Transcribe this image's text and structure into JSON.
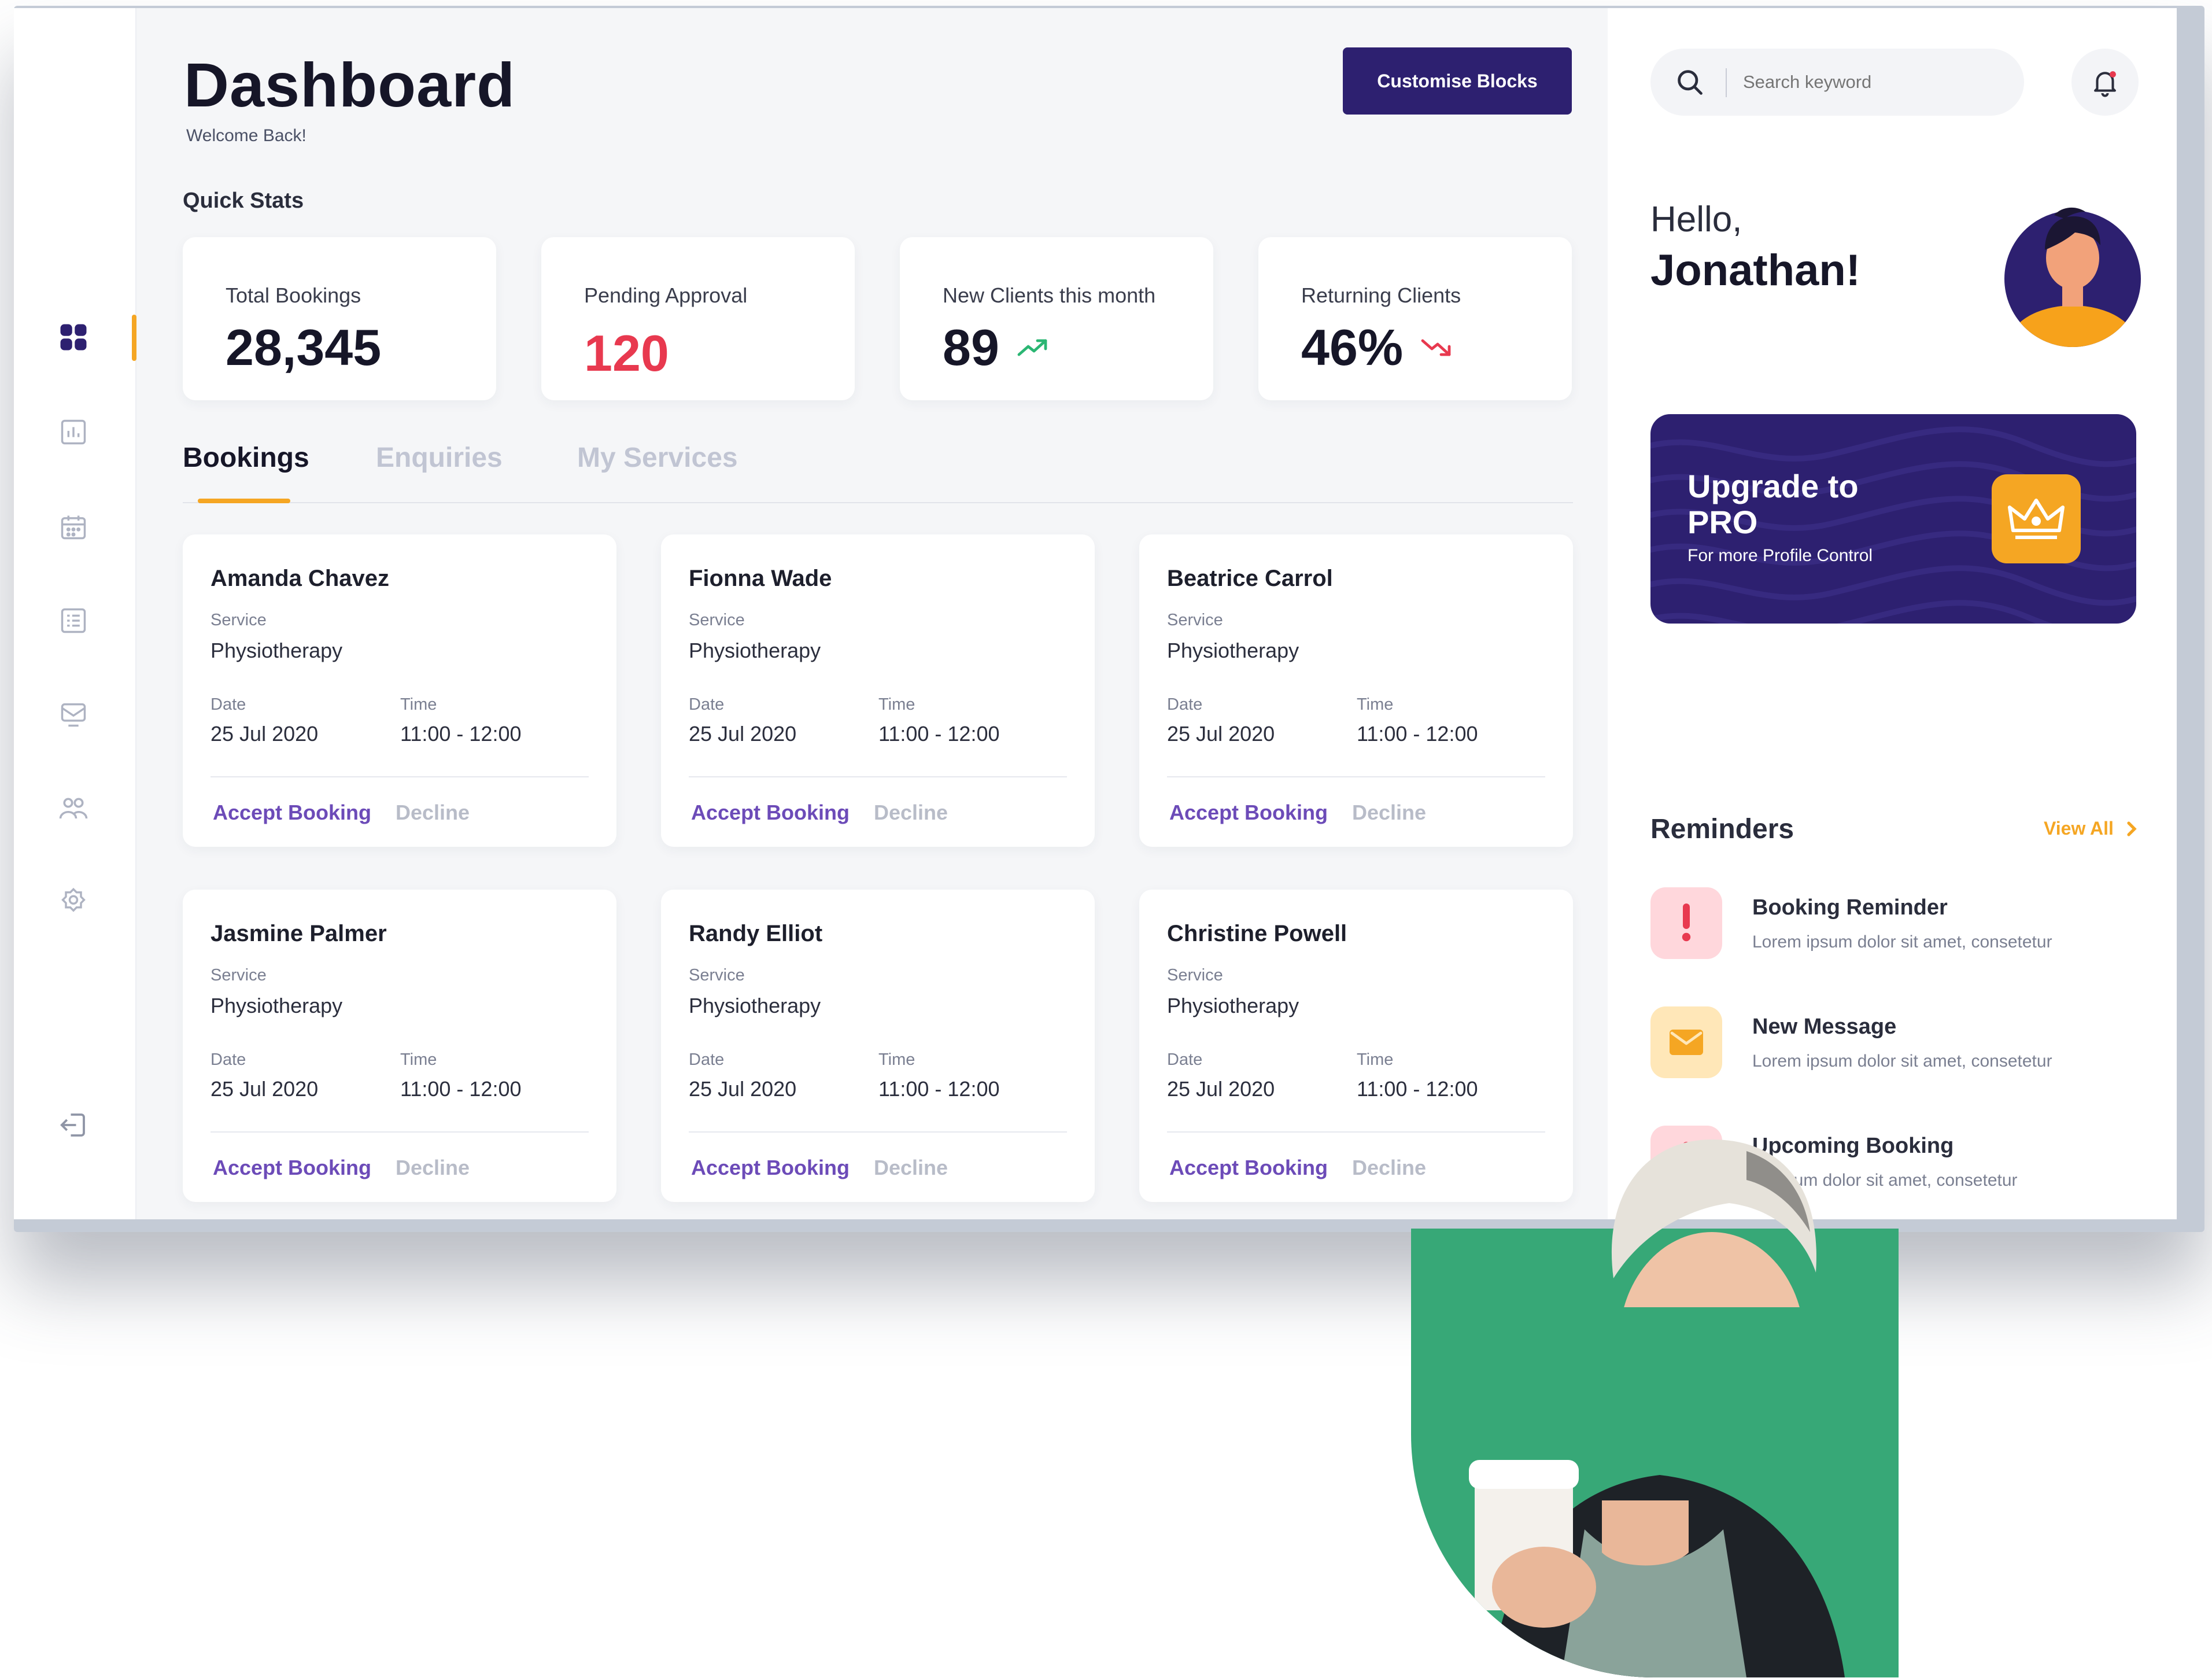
{
  "header": {
    "title": "Dashboard",
    "subtitle": "Welcome Back!",
    "customise_label": "Customise Blocks"
  },
  "quick_stats": {
    "label": "Quick Stats",
    "cards": [
      {
        "label": "Total Bookings",
        "value": "28,345",
        "trend": "none"
      },
      {
        "label": "Pending Approval",
        "value": "120",
        "trend": "none",
        "color": "#e8394f"
      },
      {
        "label": "New Clients this month",
        "value": "89",
        "trend": "up",
        "trend_color": "#2bb673"
      },
      {
        "label": "Returning Clients",
        "value": "46%",
        "trend": "down",
        "trend_color": "#e8394f"
      }
    ]
  },
  "tabs": [
    {
      "label": "Bookings",
      "active": true
    },
    {
      "label": "Enquiries",
      "active": false
    },
    {
      "label": "My Services",
      "active": false
    }
  ],
  "booking_labels": {
    "service": "Service",
    "date": "Date",
    "time": "Time",
    "accept": "Accept Booking",
    "decline": "Decline"
  },
  "bookings": [
    {
      "name": "Amanda Chavez",
      "service": "Physiotherapy",
      "date": "25 Jul 2020",
      "time": "11:00 - 12:00"
    },
    {
      "name": "Fionna Wade",
      "service": "Physiotherapy",
      "date": "25 Jul 2020",
      "time": "11:00 - 12:00"
    },
    {
      "name": "Beatrice Carrol",
      "service": "Physiotherapy",
      "date": "25 Jul 2020",
      "time": "11:00 - 12:00"
    },
    {
      "name": "Jasmine Palmer",
      "service": "Physiotherapy",
      "date": "25 Jul 2020",
      "time": "11:00 - 12:00"
    },
    {
      "name": "Randy Elliot",
      "service": "Physiotherapy",
      "date": "25 Jul 2020",
      "time": "11:00 - 12:00"
    },
    {
      "name": "Christine Powell",
      "service": "Physiotherapy",
      "date": "25 Jul 2020",
      "time": "11:00 - 12:00"
    }
  ],
  "sidebar": {
    "items": [
      {
        "icon": "dashboard-grid-icon",
        "active": true
      },
      {
        "icon": "chart-icon",
        "active": false
      },
      {
        "icon": "calendar-icon",
        "active": false
      },
      {
        "icon": "list-icon",
        "active": false
      },
      {
        "icon": "inbox-icon",
        "active": false
      },
      {
        "icon": "users-icon",
        "active": false
      },
      {
        "icon": "settings-icon",
        "active": false
      }
    ],
    "logout_icon": "logout-icon"
  },
  "right_panel": {
    "search_placeholder": "Search keyword",
    "greeting": "Hello,",
    "user_name": "Jonathan!",
    "promo": {
      "title": "Upgrade to PRO",
      "subtitle": "For more Profile Control"
    },
    "reminders": {
      "title": "Reminders",
      "view_all": "View All",
      "items": [
        {
          "title": "Booking Reminder",
          "text": "Lorem ipsum dolor sit amet, consetetur",
          "icon": "alert-icon"
        },
        {
          "title": "New Message",
          "text": "Lorem ipsum dolor sit amet, consetetur",
          "icon": "mail-icon"
        },
        {
          "title": "Upcoming Booking",
          "text": "m ipsum dolor sit amet, consetetur",
          "icon": "alert-icon"
        }
      ]
    }
  },
  "colors": {
    "accent": "#f5a623",
    "brand": "#2d2070",
    "link": "#6c4bb8",
    "photo_bg": "#37a877"
  }
}
